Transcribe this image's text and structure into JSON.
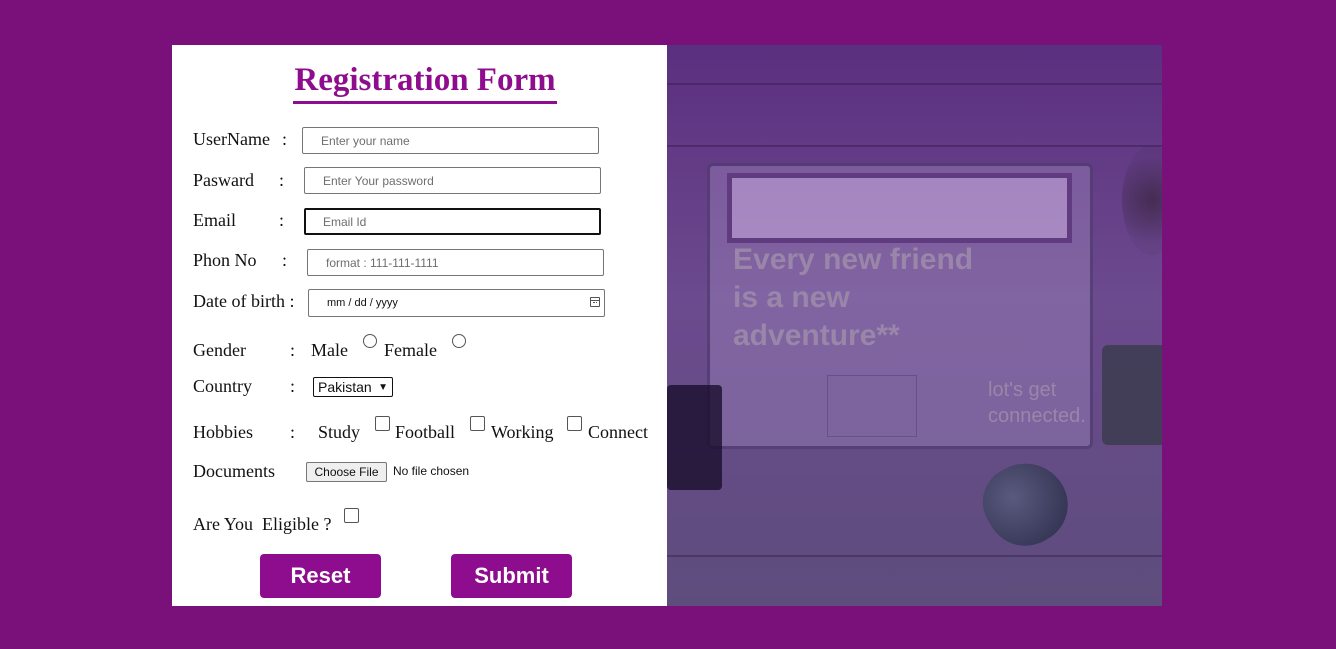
{
  "form": {
    "title": "Registration Form",
    "username": {
      "label": "UserName",
      "colon": ":",
      "placeholder": "Enter your name"
    },
    "password": {
      "label": "Pasward",
      "colon": ":",
      "placeholder": "Enter Your password"
    },
    "email": {
      "label": "Email",
      "colon": ":",
      "placeholder": "Email Id"
    },
    "phone": {
      "label": "Phon No",
      "colon": ":",
      "placeholder": "format : 111-111-1111"
    },
    "dob": {
      "label": "Date of birth :",
      "placeholder": "mm / dd / yyyy",
      "icon": "calendar-icon"
    },
    "gender": {
      "label": "Gender",
      "colon": ":",
      "options": [
        "Male",
        "Female"
      ]
    },
    "country": {
      "label": "Country",
      "colon": ":",
      "selected": "Pakistan"
    },
    "hobbies": {
      "label": "Hobbies",
      "colon": ":",
      "options": [
        "Study",
        "Football",
        "Working",
        "Connect"
      ]
    },
    "documents": {
      "label": "Documents",
      "button": "Choose File",
      "status": "No file chosen"
    },
    "eligible": {
      "label": "Are You  Eligible ?"
    },
    "reset_label": "Reset",
    "submit_label": "Submit",
    "accent_color": "#8e0d8e"
  },
  "hero": {
    "quote": "Every new friend is a new adventure**",
    "sub": "lot's get connected."
  },
  "page": {
    "background_color": "#7a117a"
  }
}
